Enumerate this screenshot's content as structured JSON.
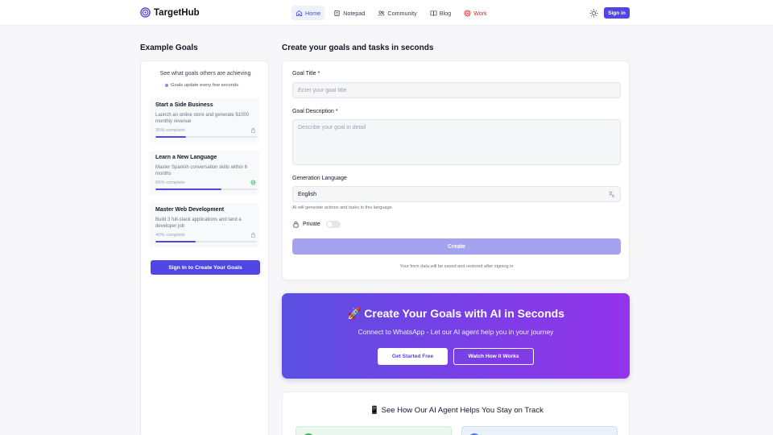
{
  "header": {
    "brand": "TargetHub",
    "nav": [
      {
        "label": "Home",
        "icon": "home-icon"
      },
      {
        "label": "Notepad",
        "icon": "notepad-icon"
      },
      {
        "label": "Community",
        "icon": "community-icon"
      },
      {
        "label": "Blog",
        "icon": "book-icon"
      },
      {
        "label": "Work",
        "icon": "target-icon"
      }
    ],
    "active_nav": "Home",
    "theme_icon": "sun-icon",
    "signin_label": "Sign in"
  },
  "left": {
    "title": "Example Goals",
    "subtitle": "See what goals others are achieving",
    "note": "Goals update every few seconds",
    "goals": [
      {
        "title": "Start a Side Business",
        "description": "Launch an online store and generate $1000 monthly revenue",
        "progress_label": "30% complete",
        "progress": 30,
        "status_icon": "lock-icon"
      },
      {
        "title": "Learn a New Language",
        "description": "Master Spanish conversation skills within 6 months",
        "progress_label": "65% complete",
        "progress": 65,
        "status_icon": "globe-icon"
      },
      {
        "title": "Master Web Development",
        "description": "Build 3 full-stack applications and land a developer job",
        "progress_label": "40% complete",
        "progress": 40,
        "status_icon": "lock-icon"
      }
    ],
    "cta_label": "Sign In to Create Your Goals"
  },
  "form": {
    "title": "Create your goals and tasks in seconds",
    "goal_title_label": "Goal Title *",
    "goal_title_placeholder": "Enter your goal title",
    "goal_desc_label": "Goal Description *",
    "goal_desc_placeholder": "Describe your goal in detail",
    "language_label": "Generation Language",
    "language_value": "English",
    "language_helper": "AI will generate actions and tasks in this language.",
    "private_label": "Private",
    "private_on": false,
    "create_label": "Create",
    "footnote": "Your form data will be saved and restored after signing in"
  },
  "promo": {
    "title": "🚀 Create Your Goals with AI in Seconds",
    "subtitle": "Connect to WhatsApp - Let our AI agent help you in your journey",
    "primary_label": "Get Started Free",
    "secondary_label": "Watch How It Works"
  },
  "agent": {
    "title": "📱 See How Our AI Agent Helps You Stay on Track"
  },
  "colors": {
    "accent": "#4f46e5",
    "work": "#dc2626",
    "promo_start": "#5b4fe0",
    "promo_end": "#9333ea"
  }
}
